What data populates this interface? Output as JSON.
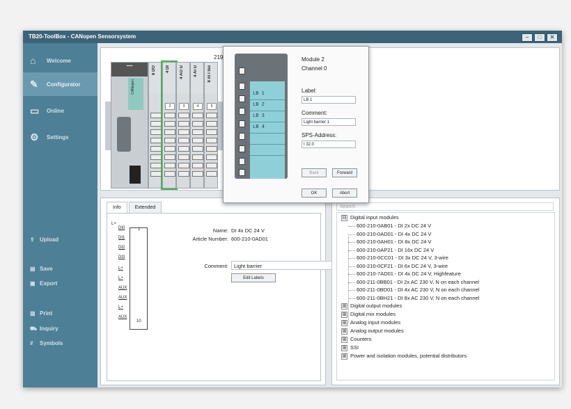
{
  "window": {
    "title": "TB20-ToolBox - CANopen Sensorsystem",
    "btn_min": "–",
    "btn_max": "□",
    "btn_close": "✕"
  },
  "sidebar": {
    "nav": [
      {
        "label": "Welcome",
        "icon": "home-icon",
        "glyph": "⌂"
      },
      {
        "label": "Configurator",
        "icon": "wrench-icon",
        "glyph": "✎"
      },
      {
        "label": "Online",
        "icon": "monitor-icon",
        "glyph": "▭"
      },
      {
        "label": "Settings",
        "icon": "gears-icon",
        "glyph": "⚙"
      }
    ],
    "actions": [
      {
        "label": "Upload",
        "icon": "upload-icon",
        "glyph": "⇪"
      },
      {
        "label": "Save",
        "icon": "save-icon",
        "glyph": "▤"
      },
      {
        "label": "Export",
        "icon": "export-icon",
        "glyph": "▣"
      },
      {
        "label": "Print",
        "icon": "print-icon",
        "glyph": "▥"
      },
      {
        "label": "Inquiry",
        "icon": "cart-icon",
        "glyph": "⛟"
      },
      {
        "label": "Symbols",
        "icon": "symbols-icon",
        "glyph": "#"
      }
    ]
  },
  "hardware": {
    "dimension": "219",
    "coupler_label": "CANopen",
    "modules": [
      {
        "label": "8 DO",
        "num": ""
      },
      {
        "label": "4 DI",
        "num": "2"
      },
      {
        "label": "4 AO U",
        "num": "3"
      },
      {
        "label": "4 AI U",
        "num": "4"
      },
      {
        "label": "8 AI I Iso",
        "num": "5"
      }
    ]
  },
  "dialog": {
    "module": "Module 2",
    "channel": "Channel 0",
    "label_caption": "Label:",
    "label_value": "LB 1",
    "comment_caption": "Comment:",
    "comment_value": "Light barrier 1",
    "sps_caption": "SPS-Address:",
    "sps_value": "I 32.0",
    "back": "Back",
    "forward": "Forward",
    "ok": "OK",
    "abort": "Abort",
    "channels": [
      "LB 1",
      "LB 2",
      "LB 3",
      "LB 4"
    ]
  },
  "info": {
    "tab_info": "Info",
    "tab_extended": "Extended",
    "name_label": "Name:",
    "name_value": "DI 4x DC 24 V",
    "article_label": "Article Number:",
    "article_value": "600-210-0AD01",
    "comment_label": "Comment:",
    "comment_value": "Light barrier",
    "edit_labels": "Edit Labels",
    "diagram": {
      "power": "L+",
      "pins": [
        "DI0",
        "DI1",
        "DI2",
        "DI3",
        "L+",
        "L+",
        "AUX",
        "AUX",
        "L+",
        "AUX"
      ],
      "numbers": [
        "1",
        "10"
      ]
    }
  },
  "catalog": {
    "search_placeholder": "Search",
    "root": "Digital input modules",
    "children": [
      "600-210-0AB01 - DI 2x DC 24 V",
      "600-210-0AD01 - DI 4x DC 24 V",
      "600-210-0AH01 - DI 8x DC 24 V",
      "600-210-0AP21 - DI 16x DC 24 V",
      "600-210-0CC01 - DI 3x DC 24 V, 3-wire",
      "600-210-0CF21 - DI 6x DC 24 V, 3-wire",
      "600-210-7AD01 - DI 4x DC 24 V, Highfeature",
      "600-211-0BB01 - DI 2x AC 230 V, N on each channel",
      "600-211-0BD01 - DI 4x AC 230 V, N on each channel",
      "600-211-0BH21 - DI 8x AC 230 V, N on each channel"
    ],
    "groups": [
      "Digital output modules",
      "Digital mix modules",
      "Analog input modules",
      "Analog output modules",
      "Counters",
      "SSI",
      "Power and isolation modules, potential distributors"
    ],
    "collapse_glyph": "⊟",
    "expand_glyph": "⊞"
  }
}
